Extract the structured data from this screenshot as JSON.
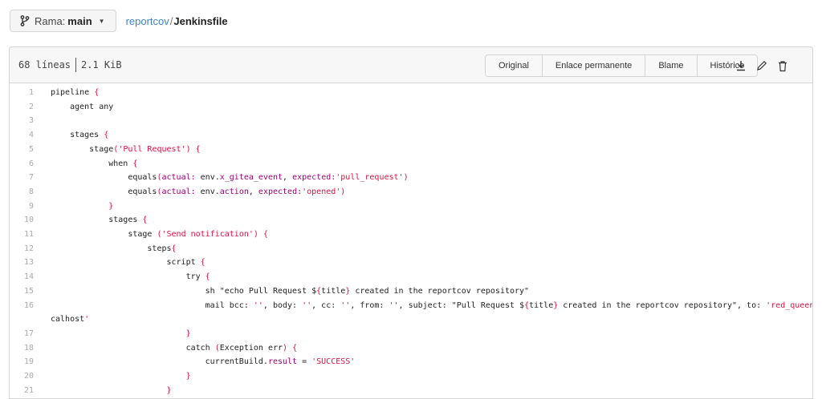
{
  "branch": {
    "prefix": "Rama:",
    "name": "main"
  },
  "breadcrumb": {
    "repo": "reportcov",
    "separator": "/",
    "file": "Jenkinsfile"
  },
  "file_header": {
    "lines": "68 líneas",
    "size": "2.1 KiB",
    "buttons": [
      "Original",
      "Enlace permanente",
      "Blame",
      "Histórico"
    ],
    "icons": [
      "download-icon",
      "edit-icon",
      "delete-icon"
    ]
  },
  "code_lines": [
    {
      "n": "1",
      "t": "pipeline {"
    },
    {
      "n": "2",
      "t": "    agent any"
    },
    {
      "n": "3",
      "t": ""
    },
    {
      "n": "4",
      "t": "    stages {"
    },
    {
      "n": "5",
      "t": "        stage('Pull Request') {"
    },
    {
      "n": "6",
      "t": "            when {"
    },
    {
      "n": "7",
      "t": "                equals(actual: env.x_gitea_event, expected:'pull_request')"
    },
    {
      "n": "8",
      "t": "                equals(actual: env.action, expected:'opened')"
    },
    {
      "n": "9",
      "t": "            }"
    },
    {
      "n": "10",
      "t": "            stages {"
    },
    {
      "n": "11",
      "t": "                stage ('Send notification') {"
    },
    {
      "n": "12",
      "t": "                    steps{"
    },
    {
      "n": "13",
      "t": "                        script {"
    },
    {
      "n": "14",
      "t": "                            try {"
    },
    {
      "n": "15",
      "t": "                                sh \"echo Pull Request ${title} created in the reportcov repository\""
    },
    {
      "n": "16",
      "t": "                                mail bcc: '', body: '', cc: '', from: '', subject: \"Pull Request ${title} created in the reportcov repository\", to: 'red_queen@lo"
    },
    {
      "n": "",
      "t": "calhost'"
    },
    {
      "n": "17",
      "t": "                            }"
    },
    {
      "n": "18",
      "t": "                            catch (Exception err) {"
    },
    {
      "n": "19",
      "t": "                                currentBuild.result = 'SUCCESS'"
    },
    {
      "n": "20",
      "t": "                            }"
    },
    {
      "n": "21",
      "t": "                        }"
    }
  ]
}
